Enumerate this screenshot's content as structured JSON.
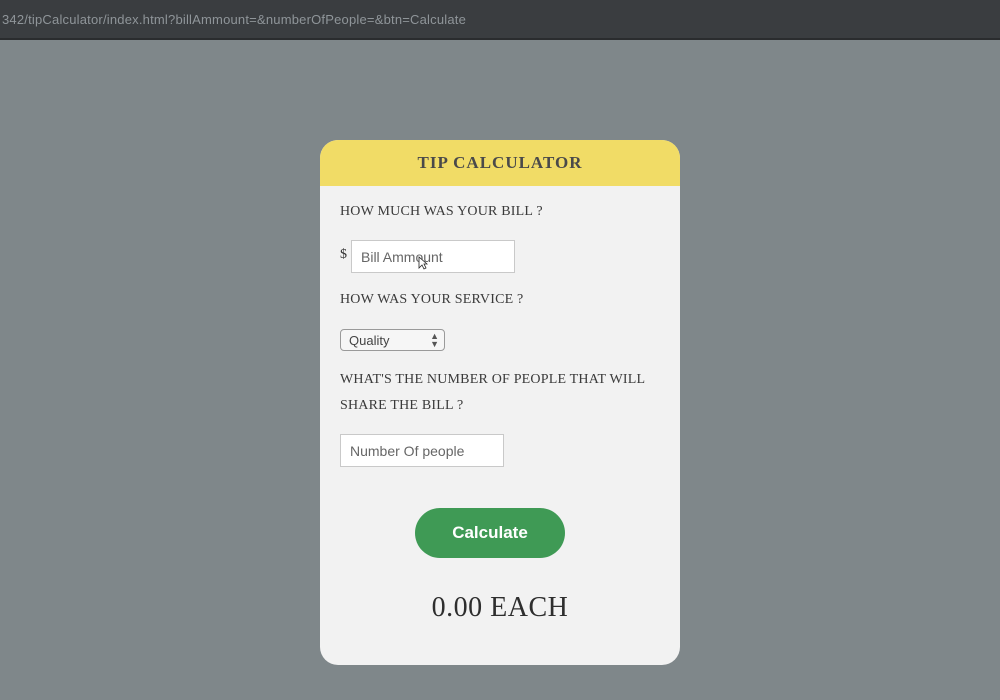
{
  "browser": {
    "url": "342/tipCalculator/index.html?billAmmount=&numberOfPeople=&btn=Calculate"
  },
  "card": {
    "title": "TIP CALCULATOR",
    "bill_question": "HOW MUCH WAS YOUR BILL ?",
    "currency_symbol": "$",
    "bill_placeholder": "Bill Ammount",
    "service_question": "HOW WAS YOUR SERVICE ?",
    "service_selected": "Quality",
    "people_question": "WHAT'S THE NUMBER OF PEOPLE THAT WILL SHARE THE BILL ?",
    "people_placeholder": "Number Of people",
    "calculate_label": "Calculate",
    "result_value": "0.00",
    "result_suffix": "EACH"
  },
  "colors": {
    "background": "#7f878a",
    "header": "#f1dc66",
    "button": "#3f9a55"
  }
}
